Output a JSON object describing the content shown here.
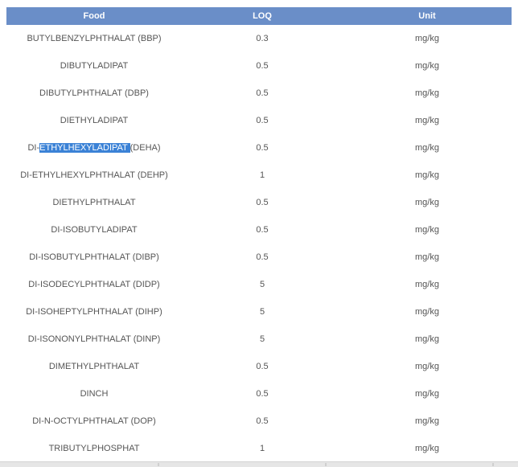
{
  "table": {
    "headers": {
      "food": "Food",
      "loq": "LOQ",
      "unit": "Unit"
    },
    "rows": [
      {
        "food": "BUTYLBENZYLPHTHALAT (BBP)",
        "loq": "0.3",
        "unit": "mg/kg"
      },
      {
        "food": "DIBUTYLADIPAT",
        "loq": "0.5",
        "unit": "mg/kg"
      },
      {
        "food": "DIBUTYLPHTHALAT (DBP)",
        "loq": "0.5",
        "unit": "mg/kg"
      },
      {
        "food": "DIETHYLADIPAT",
        "loq": "0.5",
        "unit": "mg/kg"
      },
      {
        "food_prefix": "DI-",
        "food_selected": "ETHYLHEXYLADIPAT ",
        "food_suffix": "(DEHA)",
        "loq": "0.5",
        "unit": "mg/kg"
      },
      {
        "food": "DI-ETHYLHEXYLPHTHALAT (DEHP)",
        "loq": "1",
        "unit": "mg/kg"
      },
      {
        "food": "DIETHYLPHTHALAT",
        "loq": "0.5",
        "unit": "mg/kg"
      },
      {
        "food": "DI-ISOBUTYLADIPAT",
        "loq": "0.5",
        "unit": "mg/kg"
      },
      {
        "food": "DI-ISOBUTYLPHTHALAT (DIBP)",
        "loq": "0.5",
        "unit": "mg/kg"
      },
      {
        "food": "DI-ISODECYLPHTHALAT (DIDP)",
        "loq": "5",
        "unit": "mg/kg"
      },
      {
        "food": "DI-ISOHEPTYLPHTHALAT (DIHP)",
        "loq": "5",
        "unit": "mg/kg"
      },
      {
        "food": "DI-ISONONYLPHTHALAT (DINP)",
        "loq": "5",
        "unit": "mg/kg"
      },
      {
        "food": "DIMETHYLPHTHALAT",
        "loq": "0.5",
        "unit": "mg/kg"
      },
      {
        "food": "DINCH",
        "loq": "0.5",
        "unit": "mg/kg"
      },
      {
        "food": "DI-N-OCTYLPHTHALAT (DOP)",
        "loq": "0.5",
        "unit": "mg/kg"
      },
      {
        "food": "TRIBUTYLPHOSPHAT",
        "loq": "1",
        "unit": "mg/kg"
      }
    ]
  },
  "colors": {
    "header_bg": "#6a8ec8",
    "selection": "#3b82d6"
  }
}
